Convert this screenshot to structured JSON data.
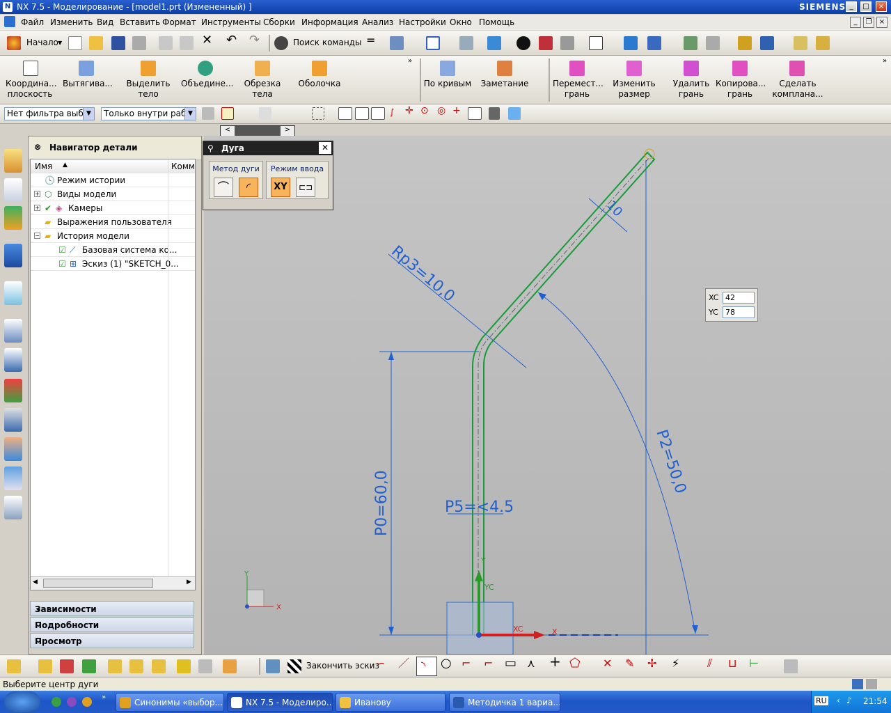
{
  "window": {
    "title": "NX 7.5 - Моделирование - [model1.prt (Измененный) ]",
    "brand": "SIEMENS"
  },
  "menu": [
    "Файл",
    "Изменить",
    "Вид",
    "Вставить",
    "Формат",
    "Инструменты",
    "Сборки",
    "Информация",
    "Анализ",
    "Настройки",
    "Окно",
    "Помощь"
  ],
  "toolbar1": {
    "start": "Начало",
    "search": "Поиск команды"
  },
  "toolbar2": [
    {
      "label1": "Координа...",
      "label2": "плоскость"
    },
    {
      "label1": "Вытягива...",
      "label2": ""
    },
    {
      "label1": "Выделить",
      "label2": "тело"
    },
    {
      "label1": "Объедине...",
      "label2": ""
    },
    {
      "label1": "Обрезка",
      "label2": "тела"
    },
    {
      "label1": "Оболочка",
      "label2": ""
    },
    {
      "label1": "По кривым",
      "label2": ""
    },
    {
      "label1": "Заметание",
      "label2": ""
    },
    {
      "label1": "Перемест...",
      "label2": "грань"
    },
    {
      "label1": "Изменить",
      "label2": "размер"
    },
    {
      "label1": "Удалить",
      "label2": "грань"
    },
    {
      "label1": "Копирова...",
      "label2": "грань"
    },
    {
      "label1": "Сделать",
      "label2": "комплана..."
    }
  ],
  "filters": {
    "type_filter": "Нет фильтра выбор",
    "scope_filter": "Только внутри рабо"
  },
  "navigator": {
    "title": "Навигатор детали",
    "col_name": "Имя",
    "col_comment": "Комм",
    "items": [
      "Режим истории",
      "Виды модели",
      "Камеры",
      "Выражения пользователя",
      "История модели",
      "Базовая система ко...",
      "Эскиз (1) \"SKETCH_0..."
    ],
    "sections": [
      "Зависимости",
      "Подробности",
      "Просмотр"
    ]
  },
  "dialog": {
    "title": "Дуга",
    "group1": "Метод дуги",
    "group2": "Режим ввода",
    "xy_label": "XY"
  },
  "coord_input": {
    "xc_label": "XC",
    "xc_value": "42",
    "yc_label": "YC",
    "yc_value": "78"
  },
  "sketch": {
    "dims": {
      "p0": "P0=60,0",
      "p2": "P2=50,0",
      "rp3": "Rp3=10,0",
      "p5": "P5=<4.5",
      "d1": "10"
    },
    "axes": {
      "xc": "XC",
      "yc": "YC",
      "x": "X",
      "y": "Y"
    }
  },
  "bottom_toolbar": {
    "finish_sketch": "Закончить эскиз"
  },
  "status": "Выберите центр дуги",
  "taskbar": {
    "tasks": [
      "Синонимы «выбор...",
      "NX 7.5 - Моделиро...",
      "Иванову",
      "Методичка 1 вариа..."
    ],
    "lang": "RU",
    "time": "21:54"
  },
  "colors": {
    "titlebar": "#0b3fa8",
    "sketch_curve": "#1a9a3a",
    "dim": "#2060d0",
    "taskbar": "#2459c8"
  }
}
